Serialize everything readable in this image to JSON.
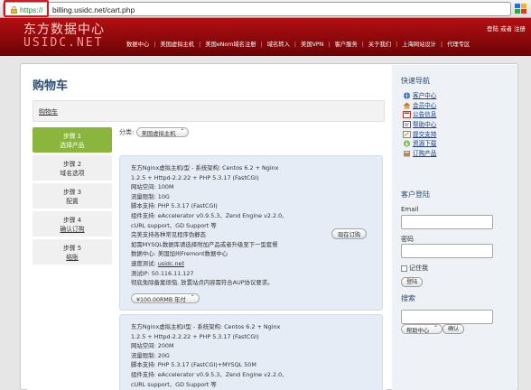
{
  "browser": {
    "url_https": "https://",
    "url_rest": "billing.usidc.net/cart.php"
  },
  "header": {
    "logo_cn": "东方数据中心",
    "logo_en": "USIDC.NET",
    "top_links": {
      "login": "登陆",
      "or": "或者",
      "register": "注册"
    },
    "nav": [
      "数据中心",
      "美国虚拟主机",
      "美国eNom域名注册",
      "域名转入",
      "美国VPN",
      "客户服务",
      "关于我们",
      "上海网站设计",
      "代理专区"
    ]
  },
  "main": {
    "title": "购物车",
    "breadcrumb": "购物车",
    "steps": [
      {
        "label": "步骤 1",
        "desc": "选择产品",
        "active": true
      },
      {
        "label": "步骤 2",
        "desc": "域名选项",
        "active": false
      },
      {
        "label": "步骤 3",
        "desc": "配置",
        "active": false
      },
      {
        "label": "步骤 4",
        "desc": "确认订购",
        "active": false
      },
      {
        "label": "步骤 5",
        "desc": "结账",
        "active": false
      }
    ],
    "category_label": "分类:",
    "category_value": "美国虚拟主机",
    "products": [
      {
        "lines": [
          "东方Nginx虚拟主机I型 - 系统架构: Centos 6.2 + Nginx",
          "1.2.5 + Httpd-2.2.22 + PHP 5.3.17 (FastCGI)",
          "网站空间: 100M",
          "流量限制: 10G",
          "脚本支持: PHP 5.3.17 (FastCGI)",
          "组件支持: eAccelerator v0.9.5.3、Zend Engine v2.2.0、",
          "cURL support、GD Support 等",
          "完美支持各种常见程序伪静态",
          "如需MYSQL数据库请选择附加产品或者升级至下一型套餐",
          "数据中心: 美国加州Fremont数据中心",
          "速度测试: "
        ],
        "url": "usidc.net",
        "lines_after": [
          "测试IP: 50.116.11.127",
          "彻底免除备案烦恼, 放置站点内容需符合AUP协议要求。"
        ],
        "order_btn": "现在订购",
        "price": "¥100.00RMB 年付"
      },
      {
        "lines": [
          "东方Nginx虚拟主机II型 - 系统架构: Centos 6.2 + Nginx",
          "1.2.5 + Httpd-2.2.22 + PHP 5.3.17 (FastCGI)",
          "网站空间: 200M",
          "流量限制: 20G",
          "脚本支持: PHP 5.3.17 (FastCGI)+MYSQL 50M",
          "组件支持: eAccelerator v0.9.5.3、Zend Engine v2.2.0、",
          "cURL support、GD Support 等"
        ]
      }
    ]
  },
  "sidebar": {
    "quick_nav_title": "快速导航",
    "quick_nav": [
      {
        "label": "客户中心",
        "icon": "globe-icon",
        "color": "#2a6bd0"
      },
      {
        "label": "会员中心",
        "icon": "home-icon",
        "color": "#d08a2a"
      },
      {
        "label": "公告信息",
        "icon": "announcement-icon",
        "color": "#c0392b"
      },
      {
        "label": "帮助中心",
        "icon": "help-icon",
        "color": "#4a4a4a"
      },
      {
        "label": "提交支持",
        "icon": "support-icon",
        "color": "#7a7a7a"
      },
      {
        "label": "资源下载",
        "icon": "download-icon",
        "color": "#3a8f3a"
      },
      {
        "label": "订购产品",
        "icon": "order-icon",
        "color": "#7a5a2a"
      }
    ],
    "login_title": "客户登陆",
    "email_label": "Email",
    "password_label": "密码",
    "remember_label": "记住我",
    "login_btn": "登陆",
    "search_title": "搜索",
    "help_select": "帮助中心",
    "confirm_btn": "确认"
  }
}
